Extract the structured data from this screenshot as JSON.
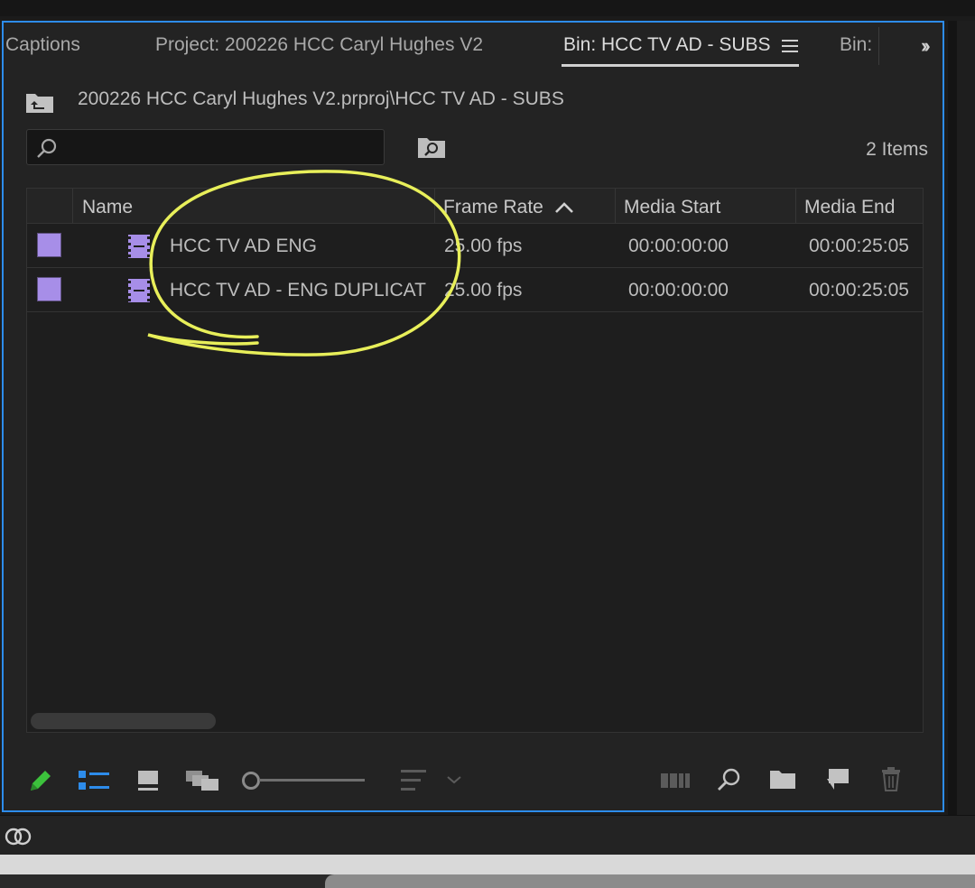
{
  "tabs": [
    {
      "label": "Captions",
      "active": false
    },
    {
      "label": "Project: 200226 HCC Caryl Hughes V2",
      "active": false
    },
    {
      "label": "Bin: HCC TV AD - SUBS",
      "active": true
    },
    {
      "label": "Bin:",
      "active": false
    }
  ],
  "path": "200226 HCC Caryl Hughes V2.prproj\\HCC TV AD - SUBS",
  "search": {
    "value": "",
    "placeholder": ""
  },
  "items_count": "2 Items",
  "columns": {
    "name": "Name",
    "frame_rate": "Frame Rate",
    "media_start": "Media Start",
    "media_end": "Media End"
  },
  "rows": [
    {
      "name": "HCC TV AD ENG",
      "frame_rate": "25.00 fps",
      "media_start": "00:00:00:00",
      "media_end": "00:00:25:05",
      "label_color": "#a78ee8"
    },
    {
      "name": "HCC TV AD - ENG DUPLICAT",
      "frame_rate": "25.00 fps",
      "media_start": "00:00:00:00",
      "media_end": "00:00:25:05",
      "label_color": "#a78ee8"
    }
  ],
  "colors": {
    "focus_border": "#2d8ceb",
    "annotation": "#e8ef5a",
    "sequence_label": "#a78ee8",
    "active_view_icon": "#2d8ceb",
    "write_icon": "#3cc23c"
  },
  "toolbar": {
    "zoom_level": 0.0,
    "icons": [
      "pencil-icon",
      "list-view-icon",
      "icon-view-icon",
      "freeform-view-icon",
      "zoom-slider",
      "sort-icons-icon",
      "automate-to-sequence-icon",
      "find-icon",
      "new-bin-icon",
      "new-item-icon",
      "clear-icon"
    ]
  }
}
